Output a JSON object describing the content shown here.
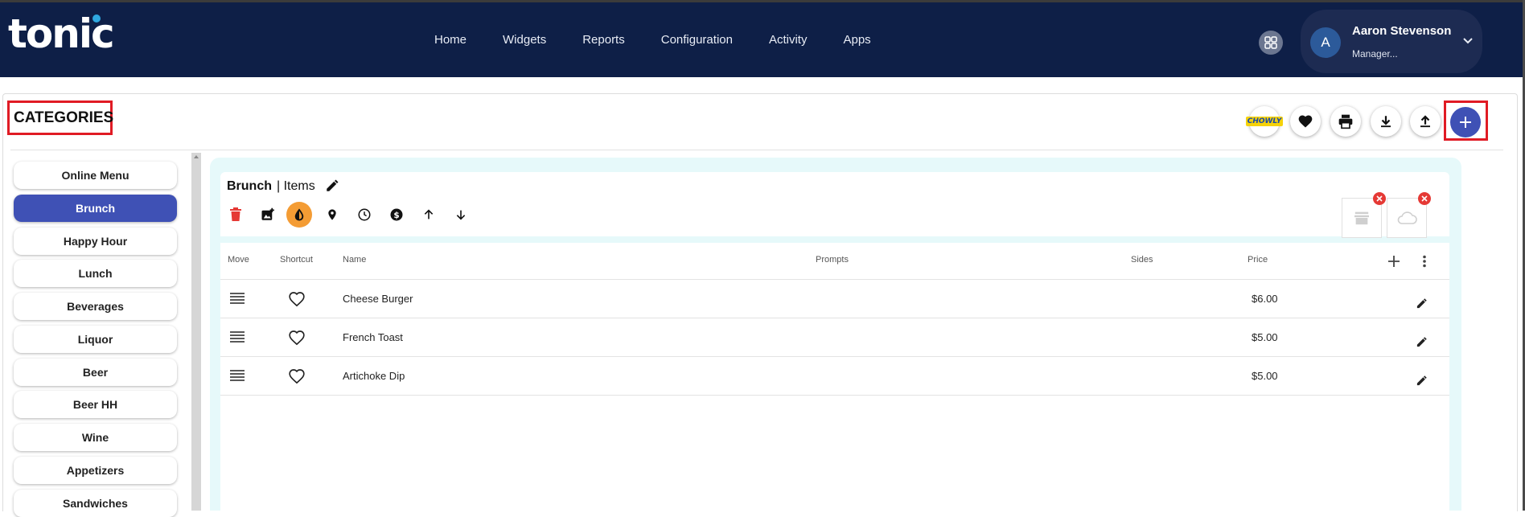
{
  "app": {
    "logo_text": "tonic"
  },
  "nav": {
    "links": [
      "Home",
      "Widgets",
      "Reports",
      "Configuration",
      "Activity",
      "Apps"
    ]
  },
  "user": {
    "avatar_letter": "A",
    "name": "Aaron Stevenson",
    "role": "Manager..."
  },
  "page": {
    "title": "CATEGORIES"
  },
  "toolbar": {
    "chowly_label": "CHOWLY",
    "add_label": "+"
  },
  "categories": [
    {
      "label": "Online Menu",
      "active": false
    },
    {
      "label": "Brunch",
      "active": true
    },
    {
      "label": "Happy Hour",
      "active": false
    },
    {
      "label": "Lunch",
      "active": false
    },
    {
      "label": "Beverages",
      "active": false
    },
    {
      "label": "Liquor",
      "active": false
    },
    {
      "label": "Beer",
      "active": false
    },
    {
      "label": "Beer HH",
      "active": false
    },
    {
      "label": "Wine",
      "active": false
    },
    {
      "label": "Appetizers",
      "active": false
    },
    {
      "label": "Sandwiches",
      "active": false
    }
  ],
  "items_panel": {
    "category_name": "Brunch",
    "separator_label": "| Items",
    "columns": {
      "move": "Move",
      "shortcut": "Shortcut",
      "name": "Name",
      "prompts": "Prompts",
      "sides": "Sides",
      "price": "Price"
    },
    "rows": [
      {
        "name": "Cheese Burger",
        "price": "$6.00"
      },
      {
        "name": "French Toast",
        "price": "$5.00"
      },
      {
        "name": "Artichoke Dip",
        "price": "$5.00"
      }
    ]
  },
  "colors": {
    "navbar": "#0e1f47",
    "accent": "#3f51b5",
    "highlight": "#e01b24",
    "active_tool": "#f49c34",
    "panel_bg": "#e6f9fa"
  }
}
